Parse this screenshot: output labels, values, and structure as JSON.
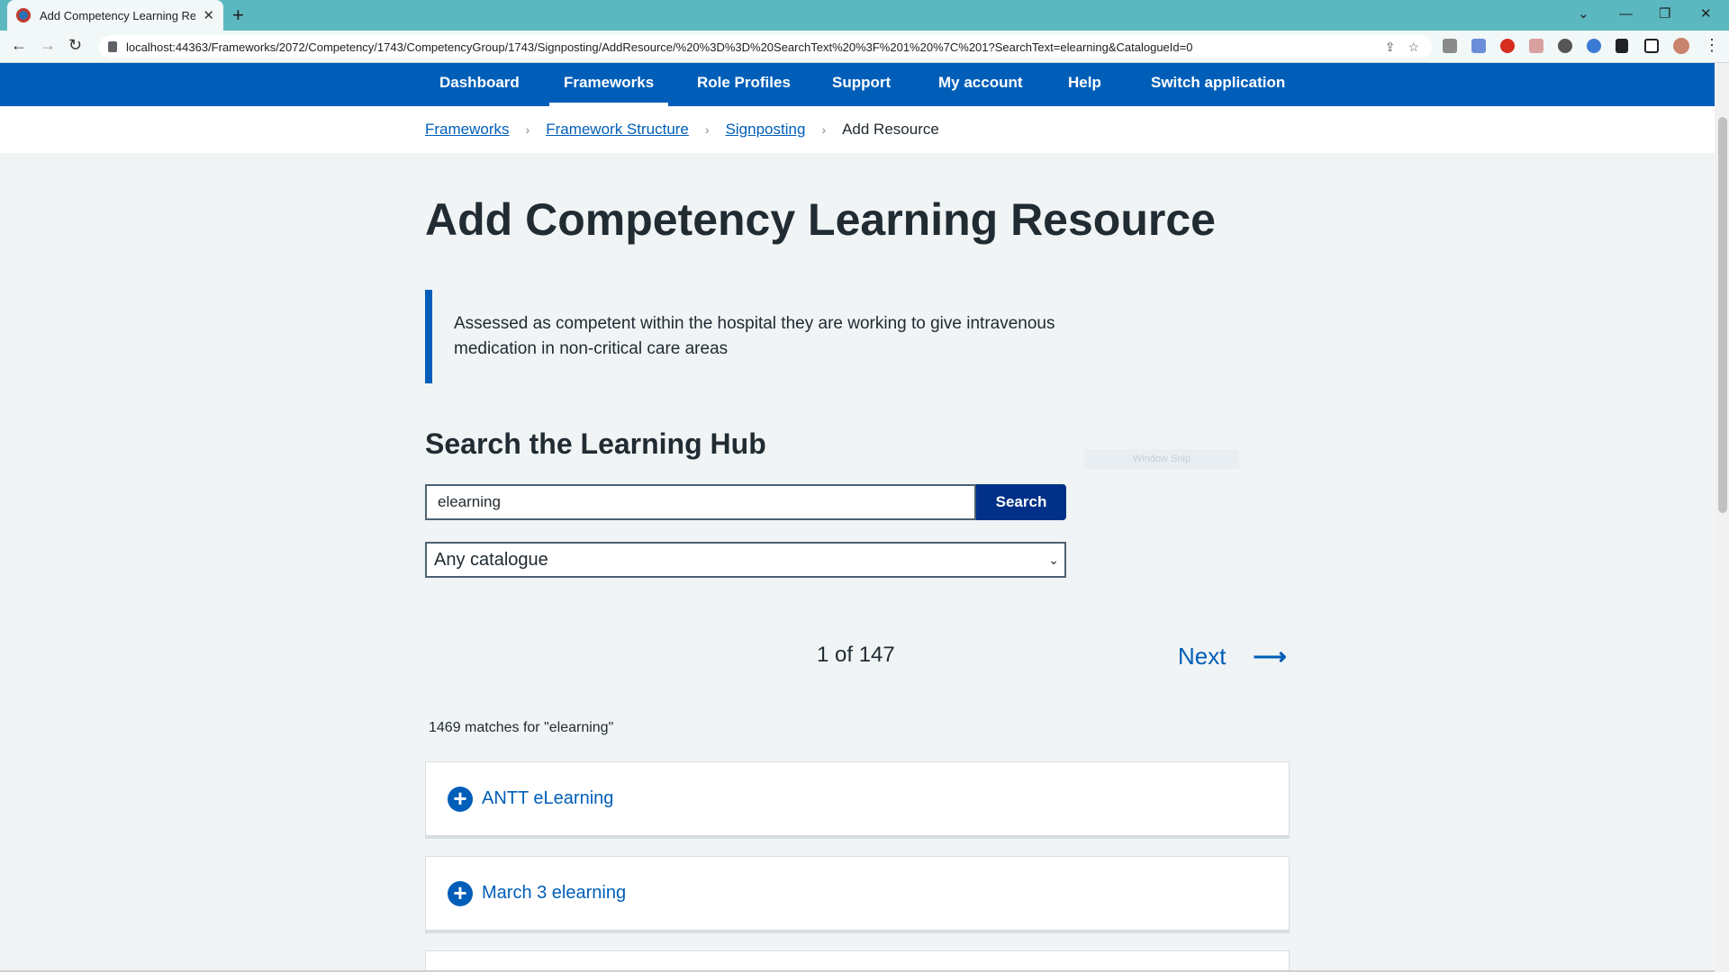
{
  "browser": {
    "tab_title": "Add Competency Learning Resou",
    "url": "localhost:44363/Frameworks/2072/Competency/1743/CompetencyGroup/1743/Signposting/AddResource/%20%3D%3D%20SearchText%20%3F%201%20%7C%201?SearchText=elearning&CatalogueId=0"
  },
  "nav": {
    "items": [
      "Dashboard",
      "Frameworks",
      "Role Profiles",
      "Support",
      "My account",
      "Help",
      "Switch application"
    ],
    "active": "Frameworks"
  },
  "breadcrumb": {
    "links": [
      "Frameworks",
      "Framework Structure",
      "Signposting"
    ],
    "current": "Add Resource"
  },
  "main": {
    "title": "Add Competency Learning Resource",
    "competency_description": "Assessed as competent within the hospital they are working to give intravenous medication in non-critical care areas",
    "search_heading": "Search the Learning Hub",
    "search_value": "elearning",
    "search_button": "Search",
    "catalogue_selected": "Any catalogue",
    "snip_overlay": "Window Snip"
  },
  "pagination": {
    "page_text": "1 of 147",
    "next_label": "Next"
  },
  "results": {
    "summary": "1469 matches for \"elearning\"",
    "items": [
      "ANTT eLearning",
      "March 3 elearning"
    ]
  },
  "colors": {
    "nhs_blue": "#005eb8",
    "dark_blue": "#003087",
    "tab_bar": "#5cb8c0"
  }
}
